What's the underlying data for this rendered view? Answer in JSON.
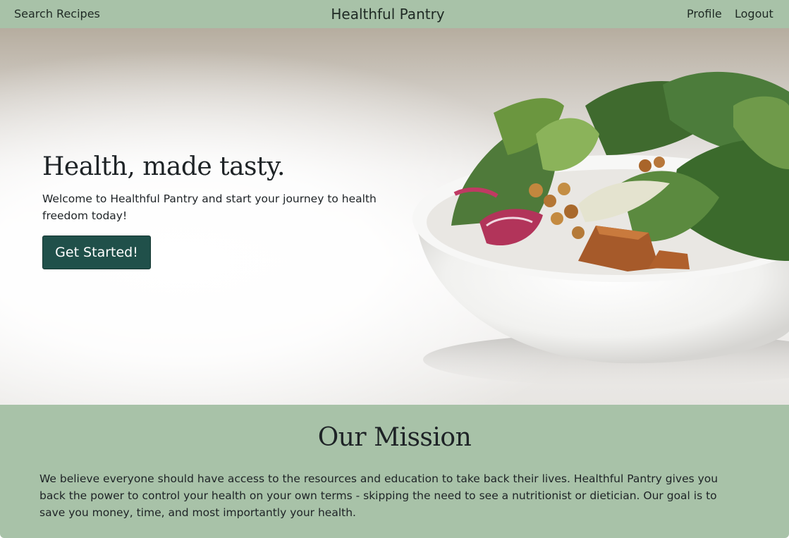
{
  "nav": {
    "search_label": "Search Recipes",
    "brand": "Healthful Pantry",
    "profile_label": "Profile",
    "logout_label": "Logout"
  },
  "hero": {
    "title": "Health, made tasty.",
    "subtitle": "Welcome to Healthful Pantry and start your journey to health freedom today!",
    "cta_label": "Get Started!",
    "image_icon": "salad-bowl-photo"
  },
  "mission": {
    "title": "Our Mission",
    "text": "We believe everyone should have access to the resources and education to take back their lives. Healthful Pantry gives you back the power to control your health on your own terms - skipping the need to see a nutritionist or dietician. Our goal is to save you money, time, and most importantly your health."
  },
  "colors": {
    "nav_background": "#a8c2a8",
    "cta_background": "#20504a",
    "text": "#1e2326"
  }
}
